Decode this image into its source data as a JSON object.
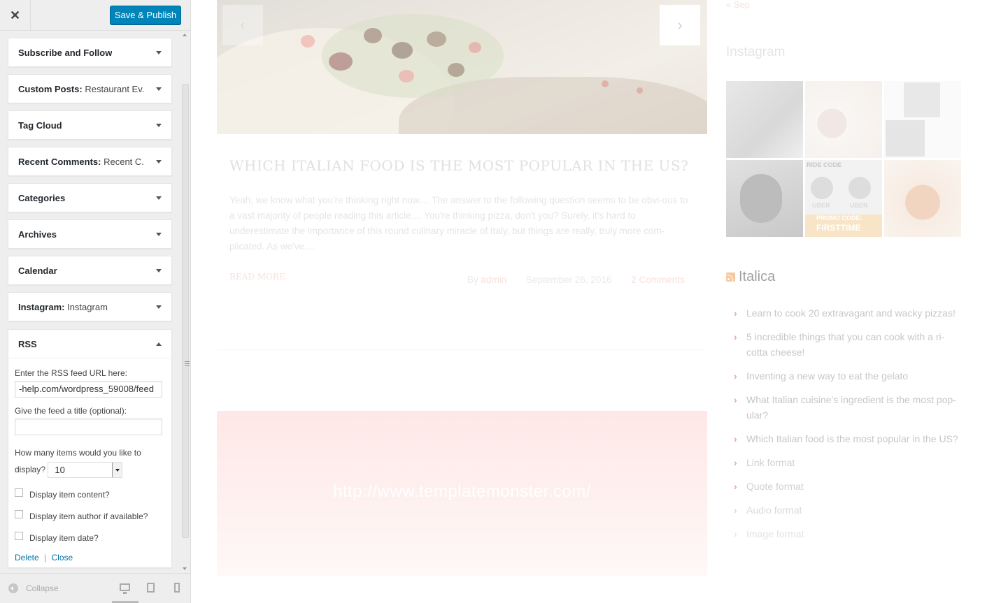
{
  "customizer": {
    "close_icon": "✕",
    "publish_label": "Save & Publish",
    "widgets": [
      {
        "title": "Subscribe and Follow",
        "sub": ""
      },
      {
        "title": "Custom Posts:",
        "sub": "Restaurant Ev..."
      },
      {
        "title": "Tag Cloud",
        "sub": ""
      },
      {
        "title": "Recent Comments:",
        "sub": "Recent C..."
      },
      {
        "title": "Categories",
        "sub": ""
      },
      {
        "title": "Archives",
        "sub": ""
      },
      {
        "title": "Calendar",
        "sub": ""
      },
      {
        "title": "Instagram:",
        "sub": "Instagram"
      },
      {
        "title": "RSS",
        "sub": ""
      }
    ],
    "rss_form": {
      "url_label": "Enter the RSS feed URL here:",
      "url_value": "-help.com/wordpress_59008/feed",
      "title_label": "Give the feed a title (optional):",
      "title_value": "",
      "count_label_1": "How many items would you like to",
      "count_label_2": "display?",
      "count_value": "10",
      "opt_content": "Display item content?",
      "opt_author": "Display item author if available?",
      "opt_date": "Display item date?",
      "delete_label": "Delete",
      "separator": "|",
      "close_label": "Close"
    },
    "footer": {
      "collapse_label": "Collapse"
    }
  },
  "preview": {
    "slider_prev": "‹",
    "slider_next": "›",
    "post": {
      "title": "WHICH ITALIAN FOOD IS THE MOST POPULAR IN THE US?",
      "excerpt": "Yeah, we know what you're thinking right now.... The answer to the following question seems to be obvi-ous to a vast majority of people reading this article.... You're thinking pizza, don't you? Surely, it's hard to underestimate the importance of this round culinary miracle of Italy, but things are really, truly more com-plicated. As we've....",
      "read_more": "READ MORE",
      "by": "By",
      "author": "admin",
      "date": "September 26, 2016",
      "comments": "2 Comments"
    },
    "link_post_url": "http://www.templatemonster.com/",
    "calendar_prev": "« Sep",
    "instagram_title": "Instagram",
    "instagram_tags": {
      "ride_code": "RIDE CODE",
      "uber": "UBER",
      "promo": "PROMO CODE:",
      "firsttime": "FIRSTTIME"
    },
    "rss_widget_title": "Italica",
    "rss_items": [
      "Learn to cook 20 extravagant and wacky pizzas!",
      "5 incredible things that you can cook with a ri-cotta cheese!",
      "Inventing a new way to eat the gelato",
      "What Italian cuisine's ingredient is the most pop-ular?",
      "Which Italian food is the most popular in the US?",
      "Link format",
      "Quote format",
      "Audio format",
      "Image format"
    ],
    "colors": {
      "accent": "#e8534a",
      "publish": "#0085ba",
      "link": "#0073aa"
    }
  }
}
